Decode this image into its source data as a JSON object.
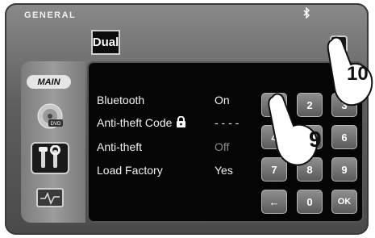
{
  "header": {
    "title": "GENERAL",
    "bluetooth_icon": "bluetooth-icon"
  },
  "brand": {
    "logo_text": "Dual"
  },
  "sidebar": {
    "main_label": "MAIN",
    "items": [
      {
        "icon": "disc-dvd-icon"
      },
      {
        "icon": "tools-settings-icon",
        "active": true
      },
      {
        "icon": "monitor-graph-icon"
      }
    ]
  },
  "settings": [
    {
      "label": "Bluetooth",
      "value": "On"
    },
    {
      "label": "Anti-theft Code",
      "value": "- - - -",
      "icon": "lock-icon"
    },
    {
      "label": "Anti-theft",
      "value": "Off",
      "dimmed": true
    },
    {
      "label": "Load Factory",
      "value": "Yes"
    }
  ],
  "keypad": {
    "keys": [
      "1",
      "2",
      "3",
      "4",
      "5",
      "6",
      "7",
      "8",
      "9",
      "←",
      "0",
      "OK"
    ]
  },
  "callouts": {
    "step_9": "9",
    "step_10": "10"
  },
  "colors": {
    "panel": "#050505",
    "bezel": "#5e5e5e",
    "key": "#7a7a7a"
  }
}
